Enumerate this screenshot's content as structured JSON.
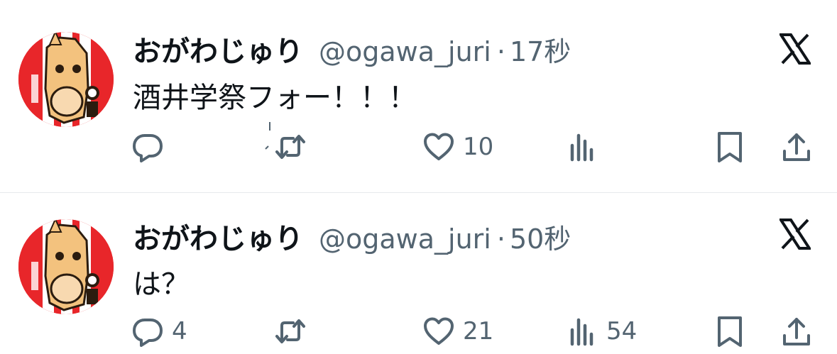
{
  "tweets": [
    {
      "author_name": "おがわじゅり",
      "handle": "@ogawa_juri",
      "separator": "·",
      "time": "17秒",
      "text": "酒井学祭フォー！！！",
      "reply_count": "",
      "retweet_count": "",
      "like_count": "10",
      "view_count": ""
    },
    {
      "author_name": "おがわじゅり",
      "handle": "@ogawa_juri",
      "separator": "·",
      "time": "50秒",
      "text": "は？",
      "reply_count": "4",
      "retweet_count": "",
      "like_count": "21",
      "view_count": "54"
    }
  ],
  "icons": {
    "brand": "x-logo-icon",
    "reply": "reply-icon",
    "retweet": "retweet-icon",
    "like": "heart-icon",
    "views": "analytics-icon",
    "bookmark": "bookmark-icon",
    "share": "share-icon"
  },
  "colors": {
    "text": "#0f1419",
    "secondary": "#536471",
    "divider": "#e6e9ec",
    "avatar_red": "#e8262a"
  }
}
